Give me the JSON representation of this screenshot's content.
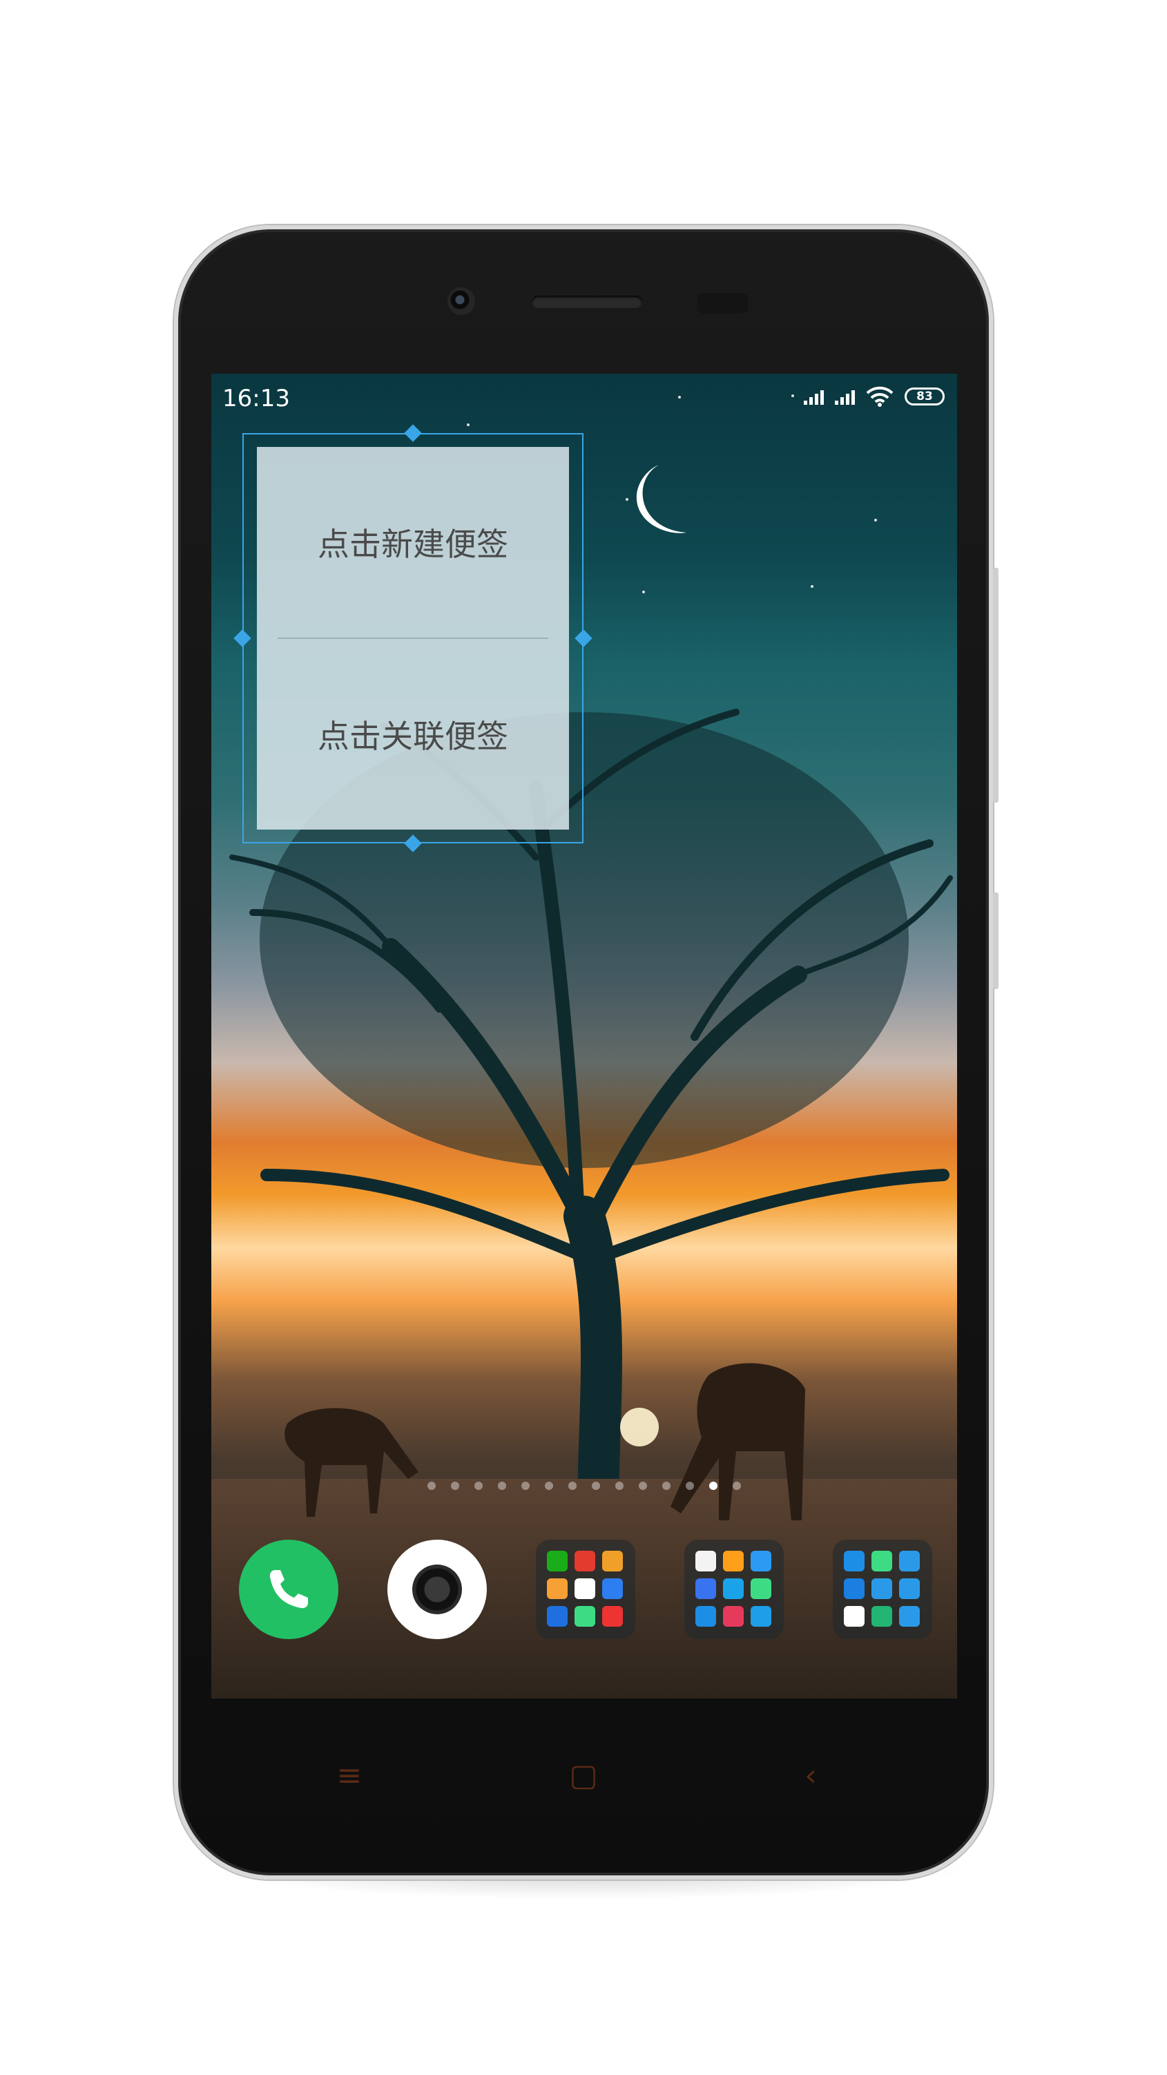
{
  "status_bar": {
    "time": "16:13",
    "battery": "83"
  },
  "note_widget": {
    "new_note_label": "点击新建便签",
    "link_note_label": "点击关联便签"
  },
  "pager": {
    "page_count": 14,
    "active_index": 12
  },
  "dock": {
    "apps": [
      {
        "name": "phone",
        "icon": "phone-icon",
        "color": "#22c064"
      },
      {
        "name": "camera",
        "icon": "camera-icon",
        "color": "#ffffff"
      }
    ],
    "folders": [
      {
        "icon_colors": [
          "#1aad19",
          "#e43b2f",
          "#f0a028",
          "#f7a035",
          "#ffffff",
          "#2d7ef0",
          "#1f6fe0",
          "#3ddc84",
          "#e33"
        ]
      },
      {
        "icon_colors": [
          "#f3f3f3",
          "#ff9f1a",
          "#2b9af3",
          "#3a73f0",
          "#1aa3e8",
          "#3ddc84",
          "#1c8ee6",
          "#e53a5c",
          "#1e9ee8"
        ]
      },
      {
        "icon_colors": [
          "#1c8ee6",
          "#3ddc84",
          "#2a9ae8",
          "#1a7fe0",
          "#2a9ae8",
          "#2a9ae8",
          "#ffffff",
          "#22b573",
          "#2a9ae8"
        ]
      }
    ]
  },
  "nav_keys": {
    "menu_glyph": "≡",
    "home_glyph": "▢",
    "back_glyph": "‹"
  }
}
